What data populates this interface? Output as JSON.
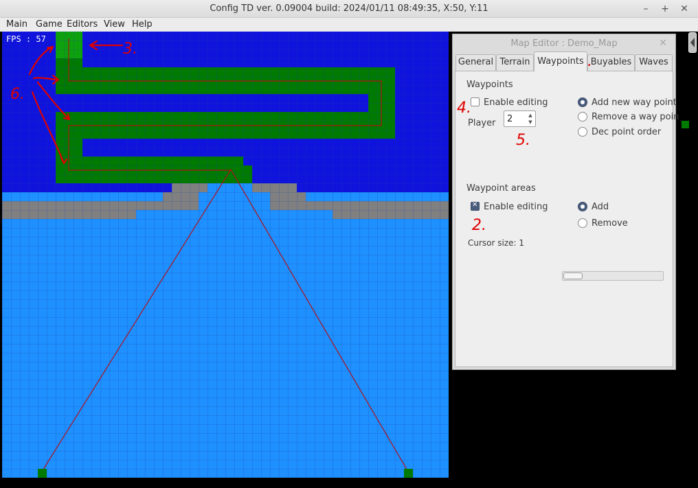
{
  "window": {
    "title": "Config TD ver. 0.09004 build: 2024/01/11  08:49:35, X:50, Y:11",
    "minimize_glyph": "–",
    "maximize_glyph": "+",
    "close_glyph": "✕"
  },
  "menu": [
    "Main",
    "Game",
    "Editors",
    "View",
    "Help"
  ],
  "game": {
    "fps_text": "FPS : 57",
    "colors": {
      "water": "#1e90ff",
      "deep": "#0f13dc",
      "path": "#007a00",
      "wall": "#808080",
      "grid": "#1a3fa8",
      "waypoint_line": "#b0101a",
      "annotation": "#e00000"
    }
  },
  "editor": {
    "title": "Map Editor : Demo_Map",
    "close_glyph": "✕",
    "tabs": [
      "General",
      "Terrain",
      "Waypoints",
      "Buyables",
      "Waves"
    ],
    "active_tab": "Waypoints",
    "waypoints": {
      "heading": "Waypoints",
      "enable_label": "Enable editing",
      "enable_checked": false,
      "player_label": "Player",
      "player_value": "2",
      "modes": [
        "Add new way point",
        "Remove a way poin",
        "Dec point order"
      ],
      "selected_mode": 0
    },
    "areas": {
      "heading": "Waypoint areas",
      "enable_label": "Enable editing",
      "enable_checked": true,
      "modes": [
        "Add",
        "Remove"
      ],
      "selected_mode": 0,
      "cursor_label": "Cursor size: 1"
    }
  },
  "annotations": [
    "1.",
    "2.",
    "3.",
    "4.",
    "5.",
    "6."
  ]
}
